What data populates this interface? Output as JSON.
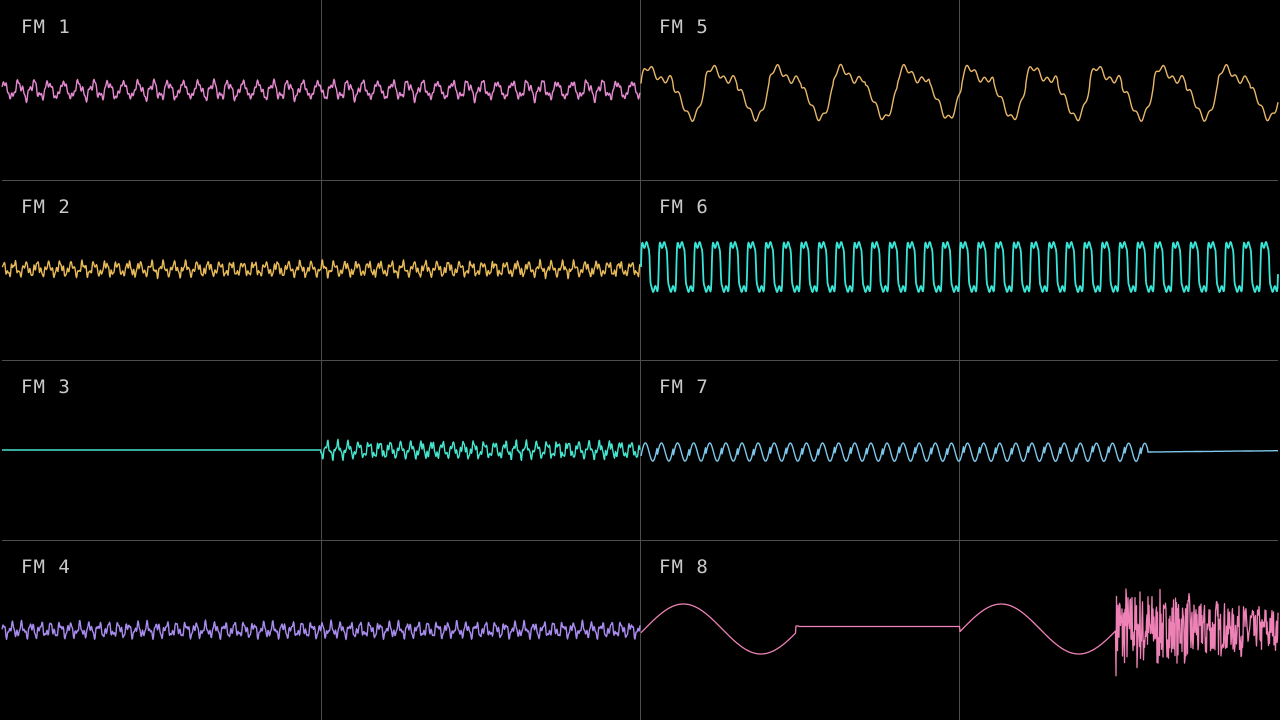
{
  "channels": [
    {
      "id": "fm1",
      "label": "FM 1",
      "color": "#e58ad0",
      "style": "dense",
      "shape": "pulse-sine",
      "amplitude": "small",
      "activity": "full"
    },
    {
      "id": "fm2",
      "label": "FM 2",
      "color": "#e8ba58",
      "style": "dense",
      "shape": "noisy-sine",
      "amplitude": "small",
      "activity": "full"
    },
    {
      "id": "fm3",
      "label": "FM 3",
      "color": "#45e6cf",
      "style": "dense",
      "shape": "noisy-sine",
      "amplitude": "small",
      "activity": "starts-at-second-half"
    },
    {
      "id": "fm4",
      "label": "FM 4",
      "color": "#a98cf0",
      "style": "dense",
      "shape": "noisy-sine",
      "amplitude": "small",
      "activity": "full"
    },
    {
      "id": "fm5",
      "label": "FM 5",
      "color": "#e8b76a",
      "style": "slow",
      "shape": "complex",
      "amplitude": "large",
      "activity": "full"
    },
    {
      "id": "fm6",
      "label": "FM 6",
      "color": "#38e6d8",
      "style": "square",
      "shape": "pulse",
      "amplitude": "large",
      "activity": "full"
    },
    {
      "id": "fm7",
      "label": "FM 7",
      "color": "#7ec8ec",
      "style": "dense",
      "shape": "saw",
      "amplitude": "medium",
      "activity": "ends-at-three-quarters"
    },
    {
      "id": "fm8",
      "label": "FM 8",
      "color": "#ee82b6",
      "style": "sine-then-noise",
      "shape": "sine-noise",
      "amplitude": "large",
      "activity": "full"
    }
  ],
  "grid": {
    "color": "#4d4d4d",
    "background": "#000000"
  }
}
